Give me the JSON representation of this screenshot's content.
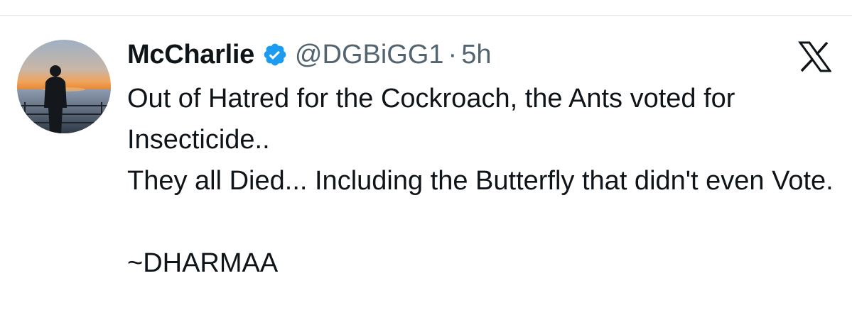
{
  "author": {
    "display_name": "McCharlie",
    "handle": "@DGBiGG1",
    "separator": "·",
    "time": "5h",
    "verified": true,
    "avatar_icon": "sunset-silhouette-avatar"
  },
  "brand": {
    "logo_icon": "x-logo-icon"
  },
  "tweet": {
    "paragraph_1": "Out of Hatred for the Cockroach, the Ants voted for Insecticide..",
    "paragraph_2": "They all Died... Including the Butterfly that didn't even Vote.",
    "signature": "~DHARMAA"
  },
  "colors": {
    "text_primary": "#0f1419",
    "text_secondary": "#536471",
    "verified_blue": "#1d9bf0",
    "divider": "#e3e6e8"
  }
}
